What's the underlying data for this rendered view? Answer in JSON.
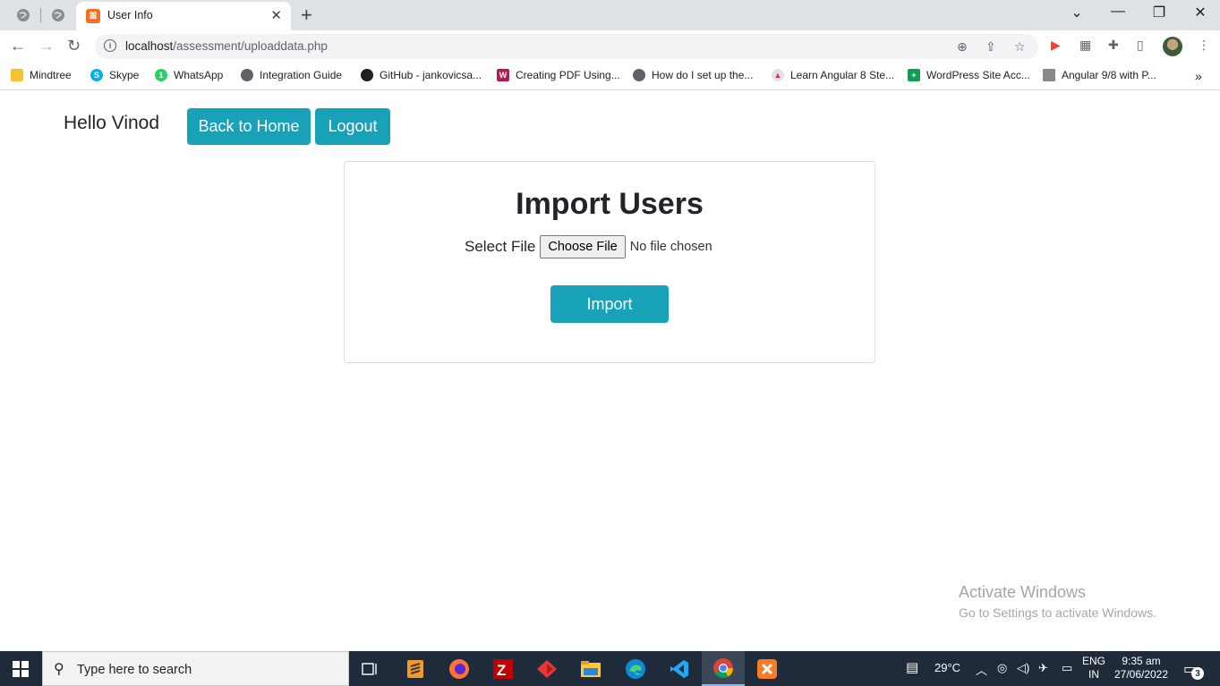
{
  "browser": {
    "tab_title": "User Info",
    "url_host": "localhost",
    "url_path": "/assessment/uploaddata.php"
  },
  "bookmarks": [
    {
      "label": "Mindtree",
      "icon": "folder-icon",
      "color": "#f4c430"
    },
    {
      "label": "Skype",
      "icon": "skype-icon",
      "color": "#00aff0"
    },
    {
      "label": "WhatsApp",
      "icon": "whatsapp-icon",
      "color": "#25d366"
    },
    {
      "label": "Integration Guide",
      "icon": "globe-icon",
      "color": "#5f6368"
    },
    {
      "label": "GitHub - jankovicsa...",
      "icon": "github-icon",
      "color": "#202124"
    },
    {
      "label": "Creating PDF Using...",
      "icon": "w-icon",
      "color": "#b5194d"
    },
    {
      "label": "How do I set up the...",
      "icon": "globe-icon",
      "color": "#5f6368"
    },
    {
      "label": "Learn Angular 8 Ste...",
      "icon": "angular-icon",
      "color": "#e0e0f0"
    },
    {
      "label": "WordPress Site Acc...",
      "icon": "sheets-icon",
      "color": "#0f9d58"
    },
    {
      "label": "Angular 9/8 with P...",
      "icon": "bars-icon",
      "color": "#888888"
    }
  ],
  "page": {
    "greeting": "Hello Vinod",
    "back_home_label": "Back to Home",
    "logout_label": "Logout",
    "card_title": "Import Users",
    "select_file_label": "Select File",
    "choose_file_label": "Choose File",
    "no_file_text": "No file chosen",
    "import_label": "Import",
    "accent_color": "#17a2b8"
  },
  "watermark": {
    "line1": "Activate Windows",
    "line2": "Go to Settings to activate Windows."
  },
  "taskbar": {
    "search_placeholder": "Type here to search",
    "temperature": "29°C",
    "language_line1": "ENG",
    "language_line2": "IN",
    "time": "9:35 am",
    "date": "27/06/2022",
    "notification_count": "3"
  }
}
